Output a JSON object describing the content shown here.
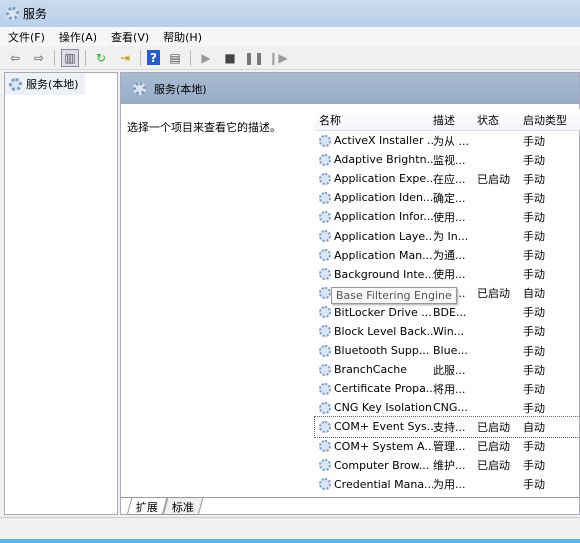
{
  "title": "服务",
  "menu": [
    "文件(F)",
    "操作(A)",
    "查看(V)",
    "帮助(H)"
  ],
  "toolbar": [
    "back-icon",
    "forward-icon",
    "show-console-tree-icon",
    "refresh-icon",
    "export-list-icon",
    "help-icon",
    "properties-icon",
    "start-icon",
    "stop-icon",
    "pause-icon",
    "resume-icon"
  ],
  "tree": {
    "root": "服务(本地)"
  },
  "main": {
    "header": "服务(本地)",
    "description": "选择一个项目来查看它的描述。",
    "columns": [
      "名称",
      "描述",
      "状态",
      "启动类型"
    ],
    "rows": [
      [
        "ActiveX Installer ...",
        "为从 ...",
        "",
        "手动"
      ],
      [
        "Adaptive Brightn...",
        "监视...",
        "",
        "手动"
      ],
      [
        "Application Expe...",
        "在应...",
        "已启动",
        "手动"
      ],
      [
        "Application Iden...",
        "确定...",
        "",
        "手动"
      ],
      [
        "Application Infor...",
        "使用...",
        "",
        "手动"
      ],
      [
        "Application Laye...",
        "为 In...",
        "",
        "手动"
      ],
      [
        "Application Man...",
        "为通...",
        "",
        "手动"
      ],
      [
        "Background Inte...",
        "使用...",
        "",
        "手动"
      ],
      [
        "Base Filtering Engine",
        "基本...",
        "已启动",
        "自动"
      ],
      [
        "BitLocker Drive ...",
        "BDE...",
        "",
        "手动"
      ],
      [
        "Block Level Back...",
        "Win...",
        "",
        "手动"
      ],
      [
        "Bluetooth Supp...",
        "Blue...",
        "",
        "手动"
      ],
      [
        "BranchCache",
        "此服...",
        "",
        "手动"
      ],
      [
        "Certificate Propa...",
        "将用...",
        "",
        "手动"
      ],
      [
        "CNG Key Isolation",
        "CNG...",
        "",
        "手动"
      ],
      [
        "COM+ Event Sys...",
        "支持...",
        "已启动",
        "自动"
      ],
      [
        "COM+ System A...",
        "管理...",
        "已启动",
        "手动"
      ],
      [
        "Computer Brow...",
        "维护...",
        "已启动",
        "手动"
      ],
      [
        "Credential Mana...",
        "为用...",
        "",
        "手动"
      ]
    ],
    "tooltip": "Base Filtering Engine",
    "tabs": [
      "扩展",
      "标准"
    ]
  }
}
